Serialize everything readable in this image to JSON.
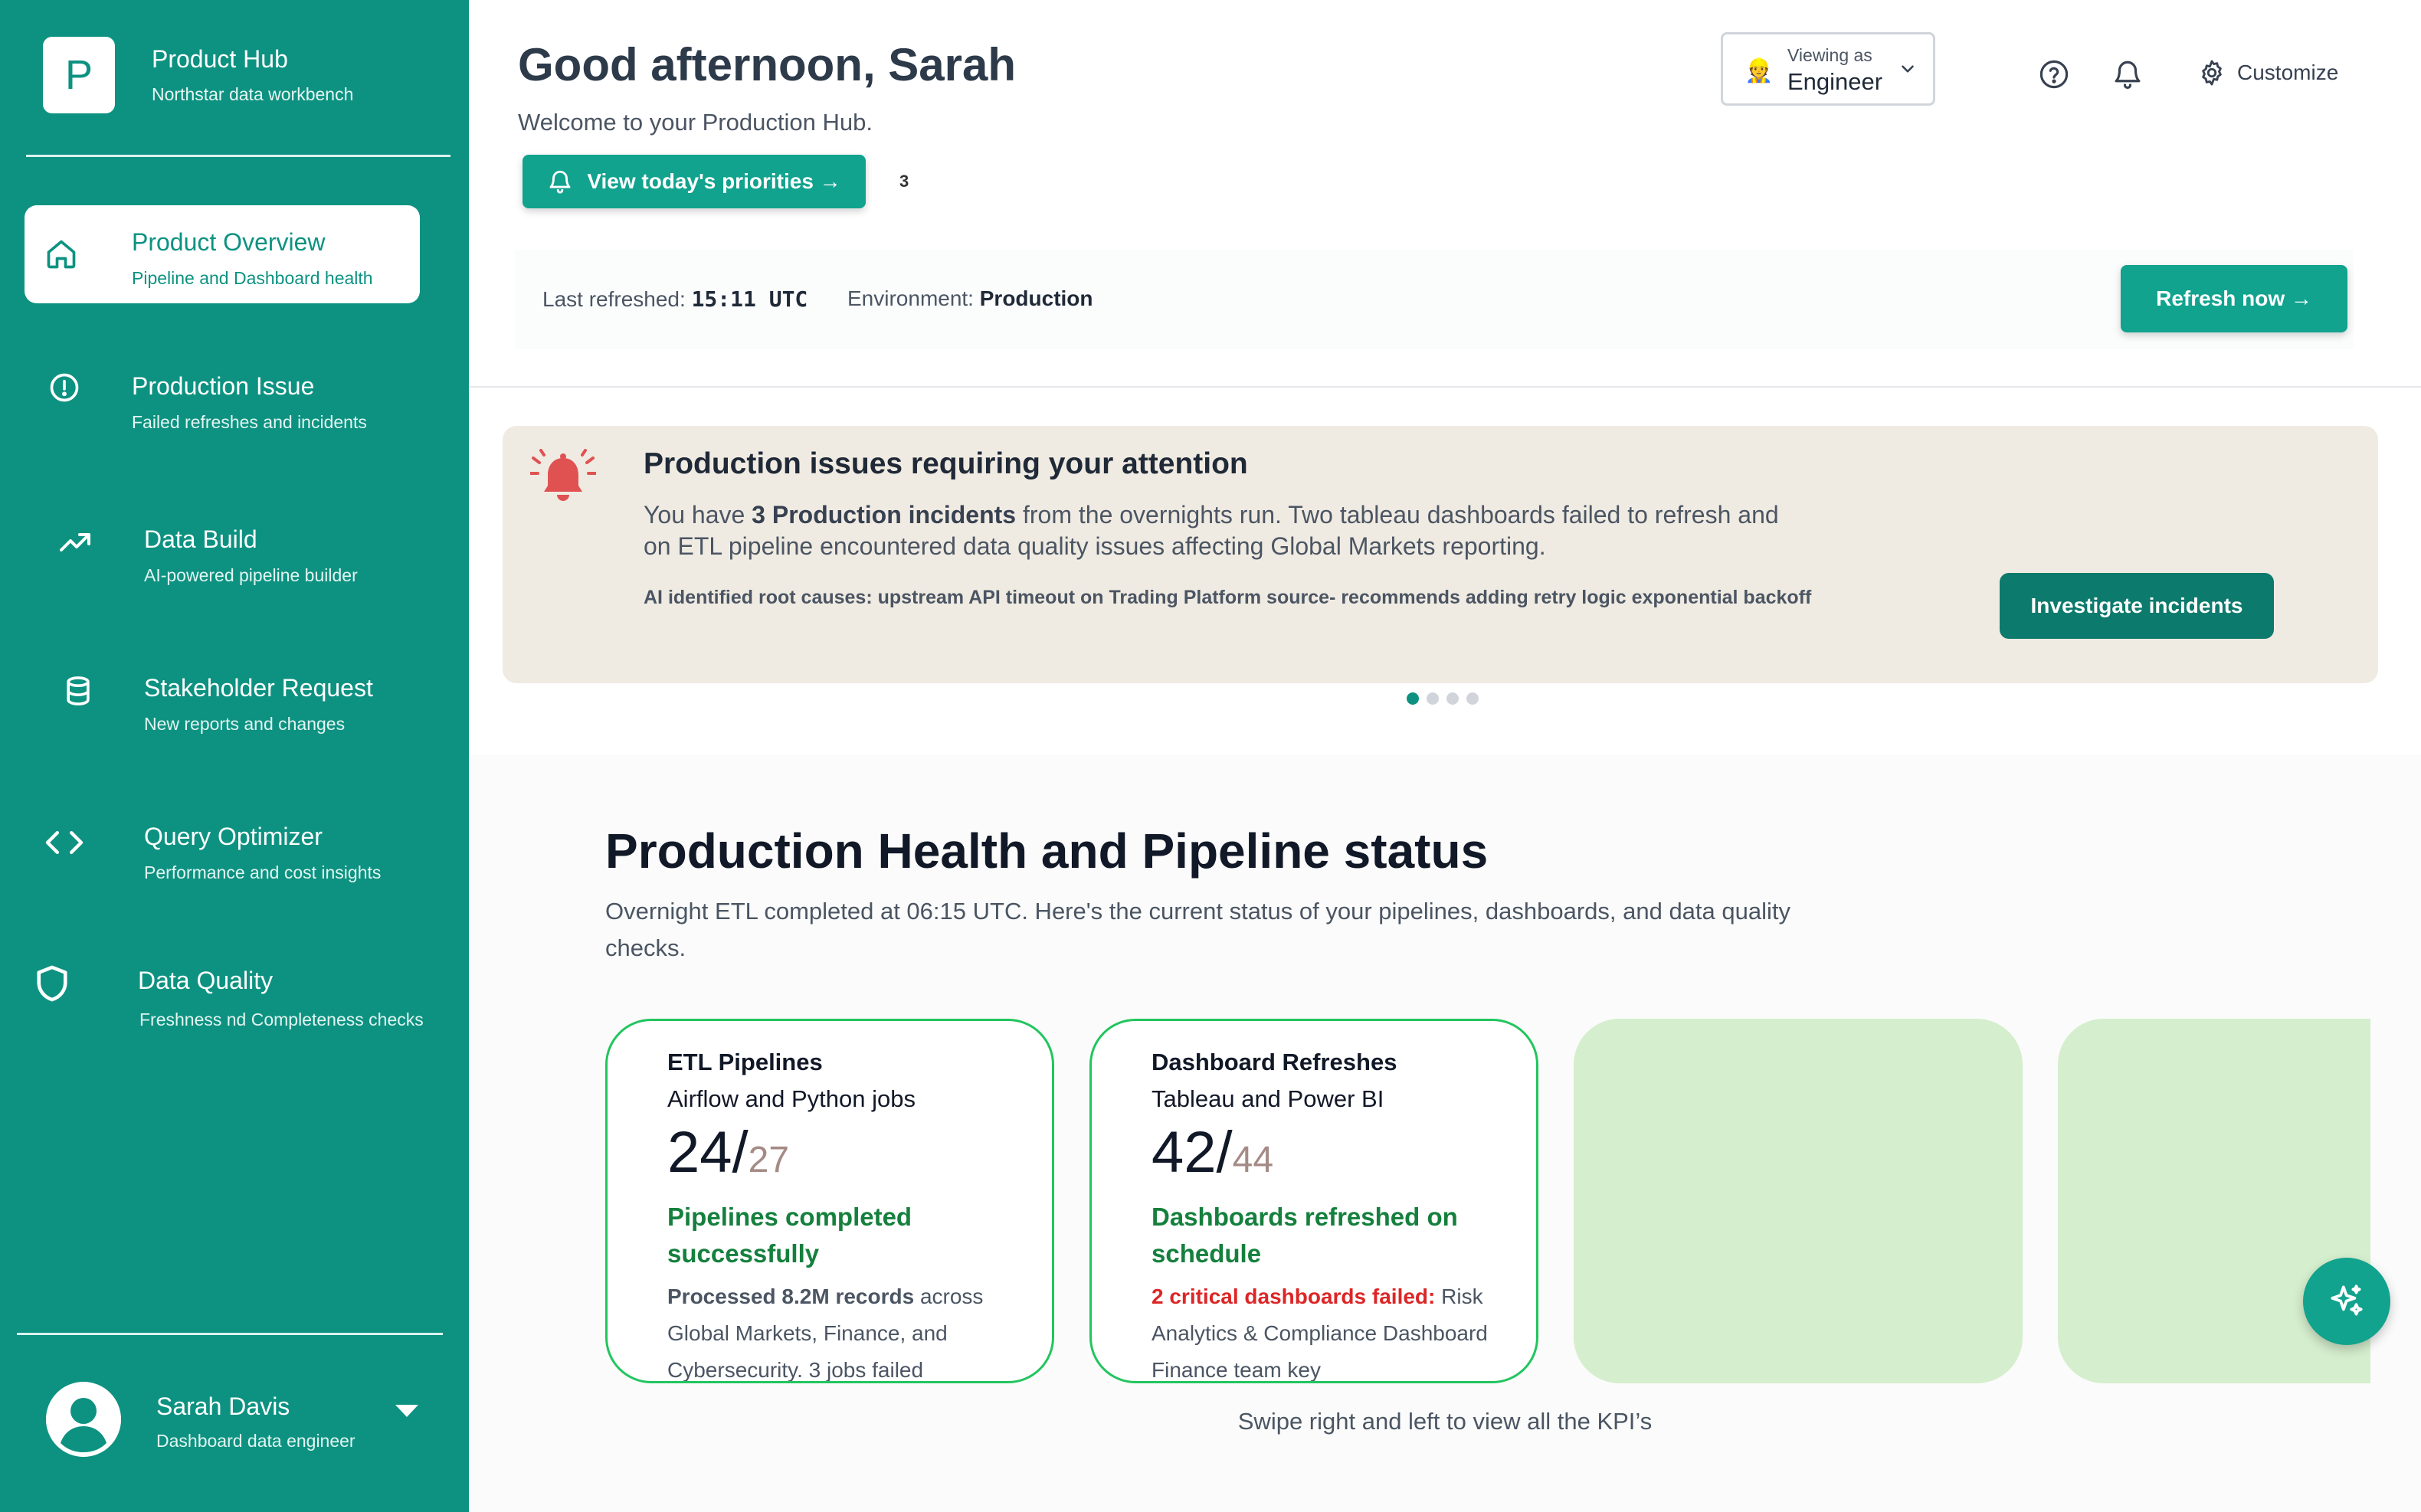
{
  "brand": {
    "logo_letter": "P",
    "title": "Product Hub",
    "subtitle": "Northstar data workbench"
  },
  "sidebar": {
    "items": [
      {
        "label": "Product Overview",
        "sub": "Pipeline and Dashboard health",
        "icon": "home-icon",
        "active": true
      },
      {
        "label": "Production Issue",
        "sub": "Failed refreshes and incidents",
        "icon": "alert-circle-icon"
      },
      {
        "label": "Data Build",
        "sub": "AI-powered pipeline builder",
        "icon": "trending-up-icon"
      },
      {
        "label": "Stakeholder Request",
        "sub": "New reports and changes",
        "icon": "database-icon"
      },
      {
        "label": "Query Optimizer",
        "sub": "Performance and cost insights",
        "icon": "code-icon"
      },
      {
        "label": "Data Quality",
        "sub": "Freshness nd Completeness checks",
        "icon": "shield-icon"
      }
    ],
    "user": {
      "name": "Sarah Davis",
      "role": "Dashboard data engineer"
    }
  },
  "header": {
    "greeting": "Good afternoon, Sarah",
    "welcome": "Welcome to your Production Hub.",
    "priorities_button": "View today's priorities →",
    "priorities_count": "3",
    "viewing_as": {
      "emoji": "👷",
      "label": "Viewing as",
      "role": "Engineer"
    },
    "customize": "Customize",
    "last_refreshed_label": "Last refreshed: ",
    "last_refreshed_value": "15:11 UTC",
    "environment_label": "Environment: ",
    "environment_value": "Production",
    "refresh_button": "Refresh now →"
  },
  "alert": {
    "title": "Production issues requiring your attention",
    "body_prefix": "You have ",
    "body_bold": "3 Production incidents",
    "body_rest": " from the overnights run. Two tableau dashboards failed to refresh and on ETL pipeline encountered data quality issues affecting Global Markets reporting.",
    "ai_note": "AI identified root causes: upstream API timeout on Trading Platform source- recommends adding retry logic exponential backoff",
    "button": "Investigate incidents",
    "carousel_active_index": 0,
    "carousel_count": 4
  },
  "health": {
    "title": "Production Health and Pipeline status",
    "description": "Overnight ETL completed at 06:15 UTC. Here's the current status of your pipelines, dashboards, and data quality checks.",
    "kpis": [
      {
        "title": "ETL Pipelines",
        "subtitle": "Airflow and Python jobs",
        "value": "24/",
        "total": "27",
        "status": "Pipelines completed successfully",
        "detail_bold": "Processed 8.2M records",
        "detail_rest": " across Global Markets, Finance, and Cybersecurity. 3 jobs failed"
      },
      {
        "title": "Dashboard Refreshes",
        "subtitle": "Tableau and Power BI",
        "value": "42/",
        "total": "44",
        "status": "Dashboards refreshed on schedule",
        "detail_bold": "2 critical dashboards failed:",
        "detail_rest": " Risk Analytics & Compliance Dashboard Finance team key"
      }
    ],
    "swipe_hint": "Swipe right and left to view all the KPI’s"
  },
  "colors": {
    "primary": "#0d9281",
    "button": "#11a38e",
    "alert_bg": "#f0ebe2",
    "success": "#15803d",
    "critical": "#dc2626",
    "kpi_border": "#22c55e",
    "ghost_card": "#d5eecd"
  }
}
